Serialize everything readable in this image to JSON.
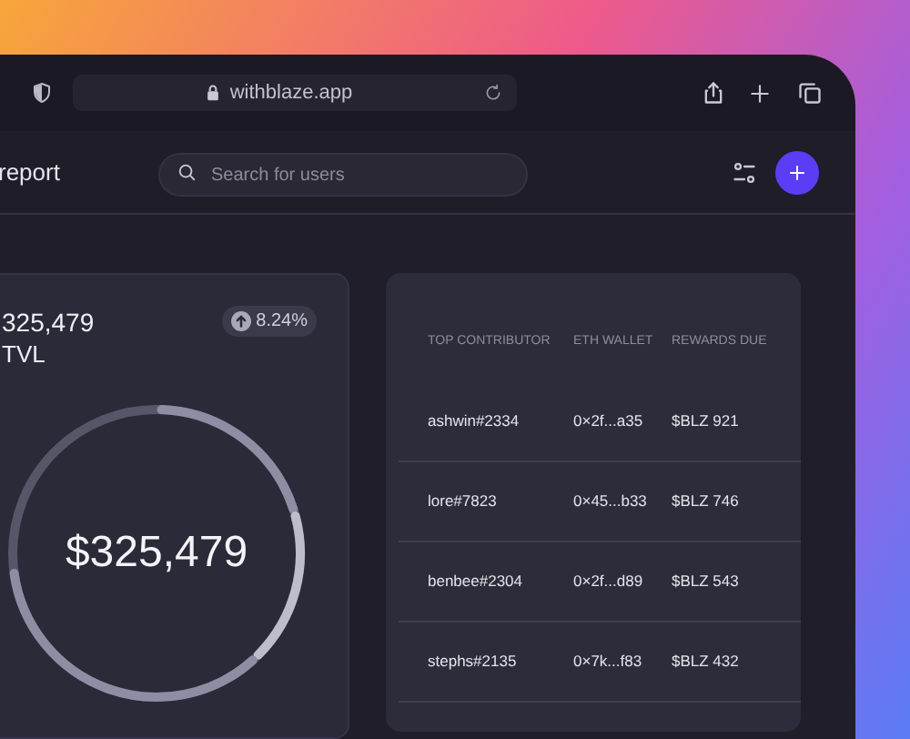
{
  "browser": {
    "url": "withblaze.app"
  },
  "header": {
    "title": "report",
    "search": {
      "placeholder": "Search for users"
    }
  },
  "tvl_card": {
    "value": "325,479",
    "label": "TVL",
    "change": "8.24%",
    "ring_value": "$325,479"
  },
  "table": {
    "columns": [
      "TOP CONTRIBUTOR",
      "ETH WALLET",
      "REWARDS DUE"
    ],
    "rows": [
      [
        "ashwin#2334",
        "0×2f...a35",
        "$BLZ 921"
      ],
      [
        "lore#7823",
        "0×45...b33",
        "$BLZ 746"
      ],
      [
        "benbee#2304",
        "0×2f...d89",
        "$BLZ 543"
      ],
      [
        "stephs#2135",
        "0×7k...f83",
        "$BLZ 432"
      ]
    ]
  }
}
